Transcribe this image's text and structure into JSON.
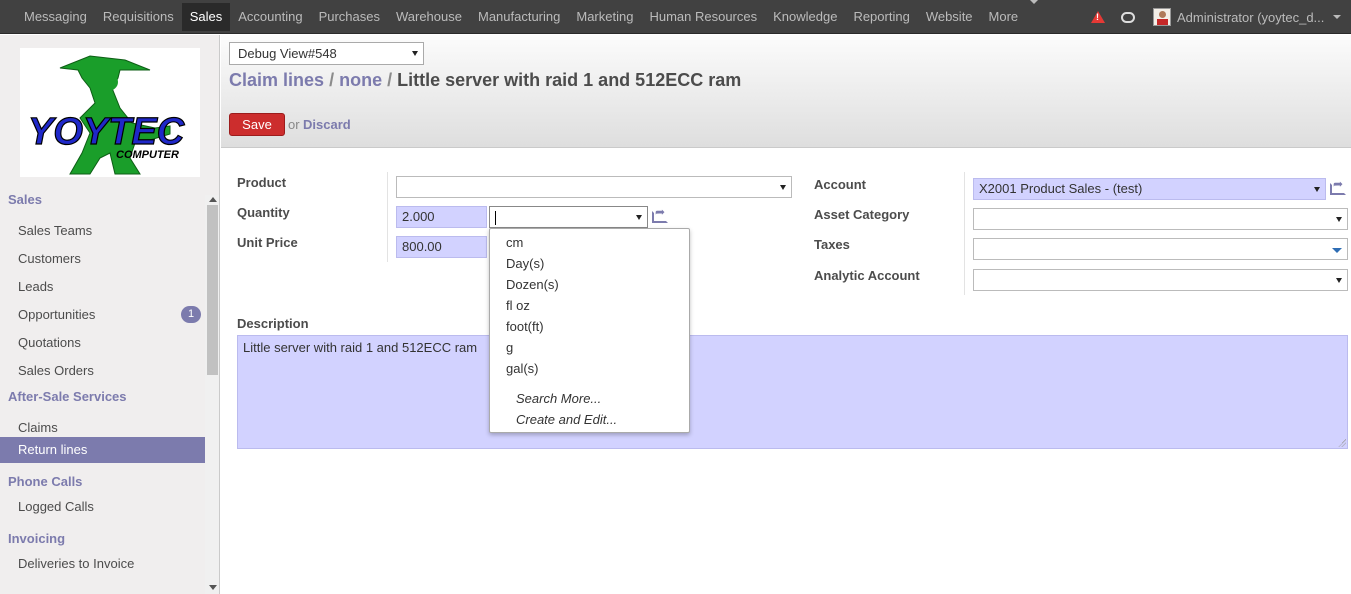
{
  "topbar": {
    "menu": [
      "Messaging",
      "Requisitions",
      "Sales",
      "Accounting",
      "Purchases",
      "Warehouse",
      "Manufacturing",
      "Marketing",
      "Human Resources",
      "Knowledge",
      "Reporting",
      "Website",
      "More"
    ],
    "active": "Sales",
    "user": "Administrator (yoytec_d..."
  },
  "sidebar": {
    "logo": {
      "text": "YOYTEC",
      "subtext": "COMPUTER"
    },
    "sections": [
      {
        "title": "Sales",
        "items": [
          {
            "label": "Sales Teams"
          },
          {
            "label": "Customers"
          },
          {
            "label": "Leads"
          },
          {
            "label": "Opportunities",
            "badge": "1"
          },
          {
            "label": "Quotations"
          },
          {
            "label": "Sales Orders"
          }
        ]
      },
      {
        "title": "After-Sale Services",
        "items": [
          {
            "label": "Claims"
          },
          {
            "label": "Return lines",
            "active": true
          }
        ]
      },
      {
        "title": "Phone Calls",
        "items": [
          {
            "label": "Logged Calls"
          }
        ]
      },
      {
        "title": "Invoicing",
        "items": [
          {
            "label": "Deliveries to Invoice"
          }
        ]
      }
    ]
  },
  "header": {
    "debug": "Debug View#548",
    "breadcrumb": [
      "Claim lines",
      "none",
      "Little server with raid 1 and 512ECC ram"
    ],
    "save": "Save",
    "or": "or",
    "discard": "Discard"
  },
  "form": {
    "product_label": "Product",
    "product_value": "",
    "quantity_label": "Quantity",
    "quantity_value": "2.000",
    "uom_value": "",
    "unit_price_label": "Unit Price",
    "unit_price_value": "800.00",
    "account_label": "Account",
    "account_value": "X2001 Product Sales - (test)",
    "asset_label": "Asset Category",
    "asset_value": "",
    "taxes_label": "Taxes",
    "taxes_value": "",
    "analytic_label": "Analytic Account",
    "analytic_value": "",
    "description_label": "Description",
    "description_value": "Little server with raid 1 and 512ECC ram"
  },
  "dropdown": {
    "options": [
      "cm",
      "Day(s)",
      "Dozen(s)",
      "fl oz",
      "foot(ft)",
      "g",
      "gal(s)"
    ],
    "search_more": "Search More...",
    "create_edit": "Create and Edit..."
  },
  "colors": {
    "accent": "#7c7bad",
    "required_bg": "#d2d2ff",
    "save": "#cc2d2d",
    "topbar": "#414141"
  }
}
